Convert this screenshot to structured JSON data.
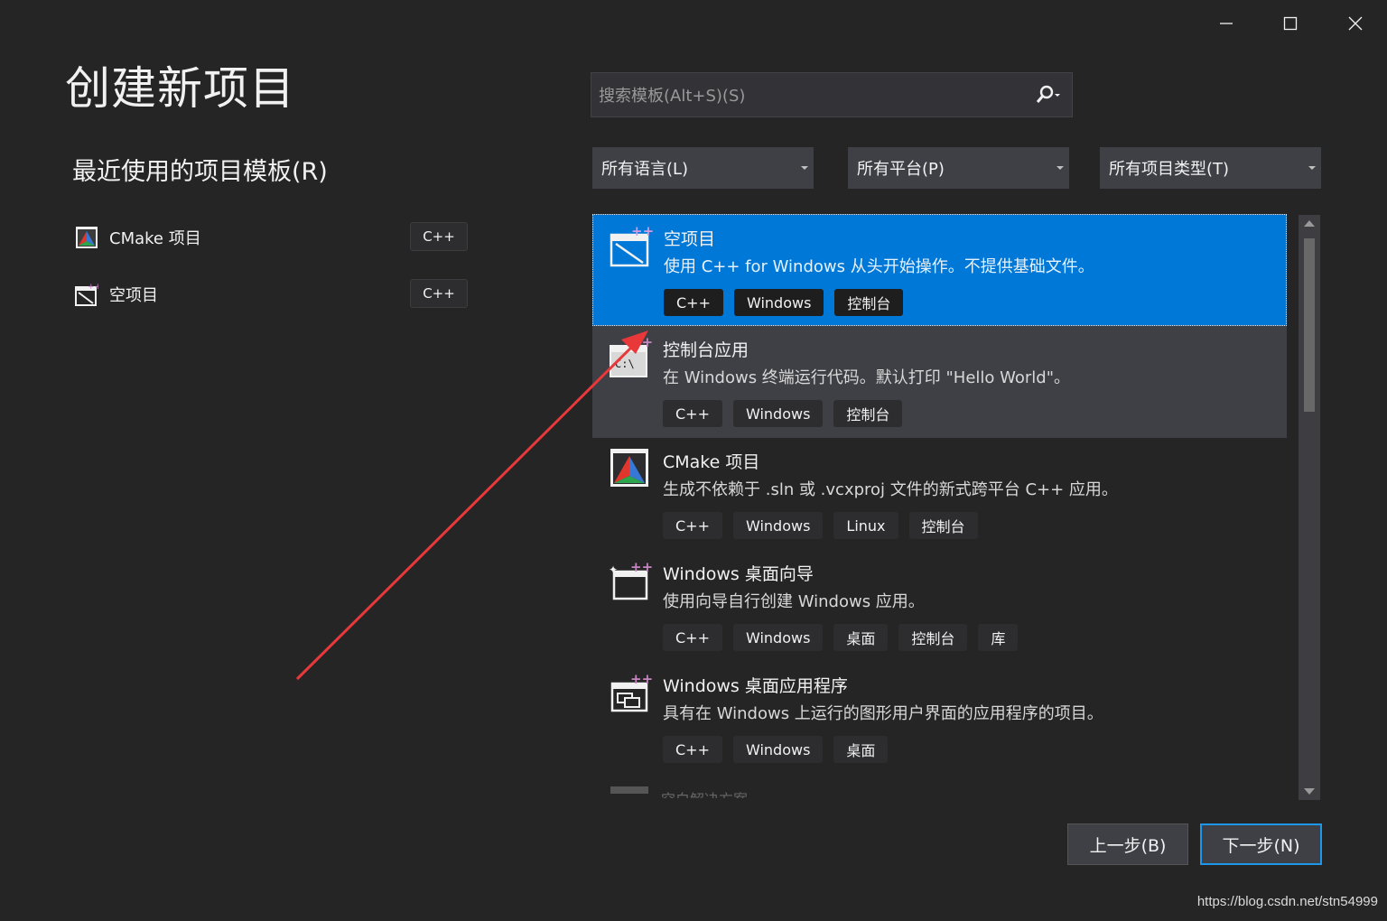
{
  "window": {
    "title": "创建新项目",
    "controls": {
      "minimize": "minimize-icon",
      "maximize": "maximize-icon",
      "close": "close-icon"
    }
  },
  "recent": {
    "header": "最近使用的项目模板(R)",
    "items": [
      {
        "label": "CMake 项目",
        "badge": "C++",
        "icon": "cmake-icon"
      },
      {
        "label": "空项目",
        "badge": "C++",
        "icon": "empty-project-icon"
      }
    ]
  },
  "search": {
    "placeholder": "搜索模板(Alt+S)(S)",
    "icon": "search-icon"
  },
  "filters": {
    "language": "所有语言(L)",
    "platform": "所有平台(P)",
    "project_type": "所有项目类型(T)"
  },
  "templates": [
    {
      "title": "空项目",
      "description": "使用 C++ for Windows 从头开始操作。不提供基础文件。",
      "tags": [
        "C++",
        "Windows",
        "控制台"
      ],
      "state": "selected"
    },
    {
      "title": "控制台应用",
      "description": "在 Windows 终端运行代码。默认打印 \"Hello World\"。",
      "tags": [
        "C++",
        "Windows",
        "控制台"
      ],
      "state": "hover"
    },
    {
      "title": "CMake 项目",
      "description": "生成不依赖于 .sln 或 .vcxproj 文件的新式跨平台 C++ 应用。",
      "tags": [
        "C++",
        "Windows",
        "Linux",
        "控制台"
      ],
      "state": "normal"
    },
    {
      "title": "Windows 桌面向导",
      "description": "使用向导自行创建 Windows 应用。",
      "tags": [
        "C++",
        "Windows",
        "桌面",
        "控制台",
        "库"
      ],
      "state": "normal"
    },
    {
      "title": "Windows 桌面应用程序",
      "description": "具有在 Windows 上运行的图形用户界面的应用程序的项目。",
      "tags": [
        "C++",
        "Windows",
        "桌面"
      ],
      "state": "normal"
    }
  ],
  "partial_item": "空白解决方案",
  "buttons": {
    "back": "上一步(B)",
    "next": "下一步(N)"
  },
  "watermark": "https://blog.csdn.net/stn54999",
  "colors": {
    "background": "#252526",
    "selected": "#0078d7",
    "accent_border": "#1c97ea",
    "annotation_arrow": "#e8383a"
  }
}
